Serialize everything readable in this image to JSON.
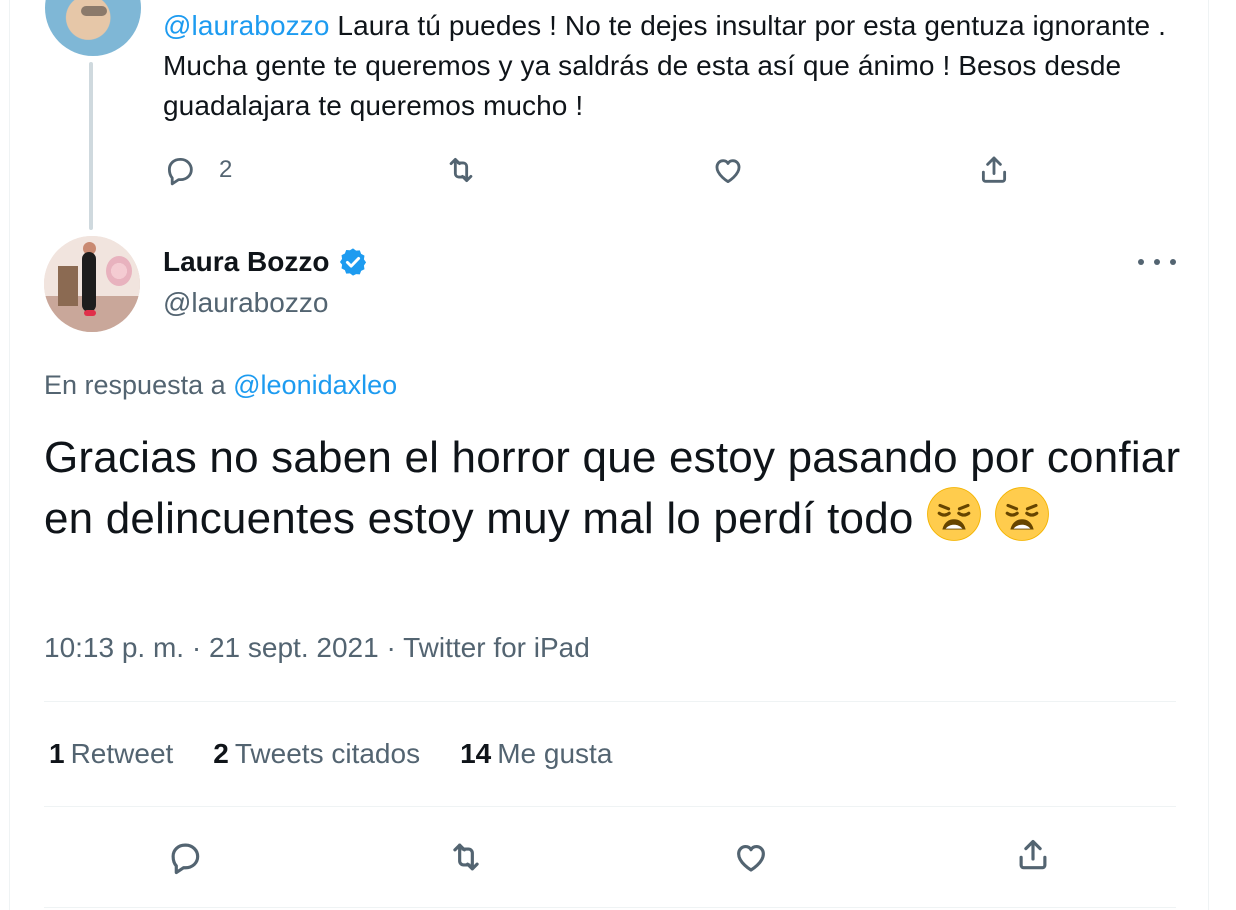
{
  "reply_tweet": {
    "mention": "@laurabozzo",
    "text": " Laura tú puedes ! No te dejes insultar por esta gentuza ignorante . Mucha gente te queremos y ya saldrás de esta así que ánimo ! Besos desde guadalajara te queremos mucho !",
    "reply_count": "2"
  },
  "main_tweet": {
    "display_name": "Laura Bozzo",
    "handle": "@laurabozzo",
    "in_reply_prefix": "En respuesta a ",
    "in_reply_handle": "@leonidaxleo",
    "text": "Gracias no saben el horror que estoy pasando por confiar en delincuentes estoy muy mal lo perdí todo",
    "time": "10:13 p. m.",
    "date": "21 sept. 2021",
    "source": "Twitter for iPad",
    "separator": " · "
  },
  "stats": {
    "retweets_count": "1",
    "retweets_label": "Retweet",
    "quotes_count": "2",
    "quotes_label": "Tweets citados",
    "likes_count": "14",
    "likes_label": "Me gusta"
  },
  "icons": {
    "reply": "reply-icon",
    "retweet": "retweet-icon",
    "like": "heart-icon",
    "share": "share-icon",
    "verified": "verified-badge-icon",
    "more": "more-icon",
    "emoji": "weary-face-emoji"
  },
  "colors": {
    "accent": "#1d9bf0",
    "secondary_text": "#536471",
    "primary_text": "#0f1419"
  }
}
